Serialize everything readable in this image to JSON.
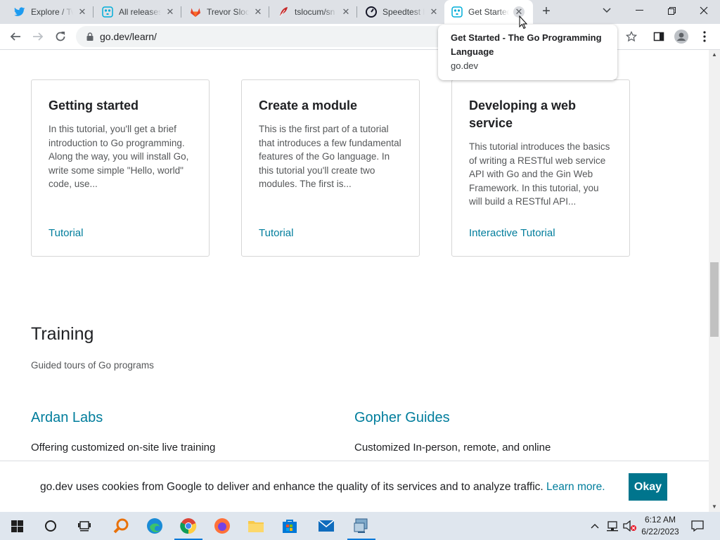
{
  "browser": {
    "tabs": [
      {
        "title": "Explore / Tw",
        "icon": "twitter-icon"
      },
      {
        "title": "All releases",
        "icon": "gopher-icon"
      },
      {
        "title": "Trevor Sloc",
        "icon": "gitlab-icon"
      },
      {
        "title": "tslocum/sn",
        "icon": "feather-icon"
      },
      {
        "title": "Speedtest b",
        "icon": "speedtest-icon"
      },
      {
        "title": "Get Started",
        "icon": "gopher-icon",
        "active": true
      }
    ],
    "url": "go.dev/learn/",
    "tooltip": {
      "title": "Get Started - The Go Programming Language",
      "domain": "go.dev"
    }
  },
  "cards": [
    {
      "title": "Getting started",
      "description": "In this tutorial, you'll get a brief introduction to Go programming. Along the way, you will install Go, write some simple \"Hello, world\" code, use...",
      "link": "Tutorial"
    },
    {
      "title": "Create a module",
      "description": "This is the first part of a tutorial that introduces a few fundamental features of the Go language. In this tutorial you'll create two modules. The first is...",
      "link": "Tutorial"
    },
    {
      "title": "Developing a web service",
      "description": "This tutorial introduces the basics of writing a RESTful web service API with Go and the Gin Web Framework. In this tutorial, you will build a RESTful API...",
      "link": "Interactive Tutorial"
    }
  ],
  "training": {
    "heading": "Training",
    "subheading": "Guided tours of Go programs",
    "orgs": [
      {
        "name": "Ardan Labs",
        "description": "Offering customized on-site live training"
      },
      {
        "name": "Gopher Guides",
        "description": "Customized In-person, remote, and online"
      }
    ]
  },
  "cookie": {
    "message": "go.dev uses cookies from Google to deliver and enhance the quality of its services and to analyze traffic.",
    "link": "Learn more.",
    "button": "Okay"
  },
  "taskbar": {
    "time": "6:12 AM",
    "date": "6/22/2023"
  },
  "colors": {
    "link": "#007d9c",
    "button": "#00758d",
    "tab_strip": "#dee1e6",
    "taskbar": "#dfe6ee"
  }
}
